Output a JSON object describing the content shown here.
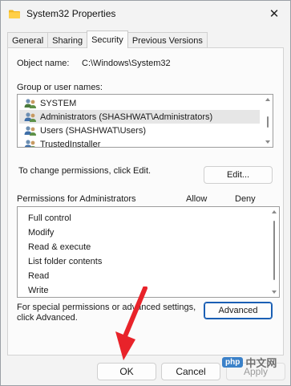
{
  "window": {
    "title": "System32 Properties",
    "close_glyph": "✕"
  },
  "tabs": [
    {
      "label": "General",
      "active": false
    },
    {
      "label": "Sharing",
      "active": false
    },
    {
      "label": "Security",
      "active": true
    },
    {
      "label": "Previous Versions",
      "active": false
    }
  ],
  "security": {
    "object_name_label": "Object name:",
    "object_name_value": "C:\\Windows\\System32",
    "group_label": "Group or user names:",
    "users": [
      {
        "name": "SYSTEM",
        "icon": "users-group-icon",
        "selected": false
      },
      {
        "name": "Administrators (SHASHWAT\\Administrators)",
        "icon": "users-group-icon",
        "selected": true
      },
      {
        "name": "Users (SHASHWAT\\Users)",
        "icon": "users-group-icon",
        "selected": false
      },
      {
        "name": "TrustedInstaller",
        "icon": "users-group-icon",
        "selected": false
      }
    ],
    "change_text": "To change permissions, click Edit.",
    "edit_button": "Edit...",
    "permissions_label": "Permissions for Administrators",
    "allow_label": "Allow",
    "deny_label": "Deny",
    "permissions": [
      "Full control",
      "Modify",
      "Read & execute",
      "List folder contents",
      "Read",
      "Write"
    ],
    "special_text_1": "For special permissions or advanced settings,",
    "special_text_2": "click Advanced.",
    "advanced_button": "Advanced"
  },
  "footer": {
    "ok": "OK",
    "cancel": "Cancel",
    "apply": "Apply"
  },
  "watermark": {
    "badge": "php",
    "text": "中文网"
  },
  "colors": {
    "accent": "#1a5fb4",
    "annotation_arrow": "#e8232a",
    "selected_row": "#e6e6e6"
  }
}
